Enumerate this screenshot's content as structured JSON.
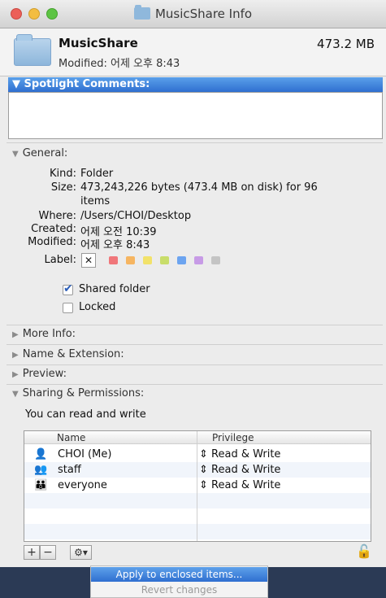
{
  "window": {
    "title": "MusicShare Info"
  },
  "header": {
    "name": "MusicShare",
    "modified": "Modified: 어제 오후 8:43",
    "size": "473.2 MB"
  },
  "spotlight": {
    "title": "Spotlight Comments:"
  },
  "general": {
    "title": "General:",
    "kind_key": "Kind:",
    "kind": "Folder",
    "size_key": "Size:",
    "size_line1": "473,243,226 bytes (473.4 MB on disk) for 96",
    "size_line2": "items",
    "where_key": "Where:",
    "where": "/Users/CHOI/Desktop",
    "created_key": "Created:",
    "created": "어제 오전 10:39",
    "modified_key": "Modified:",
    "modified": "어제 오후 8:43",
    "label_key": "Label:",
    "label_none": "✕",
    "label_colors": [
      "#f0767a",
      "#f6b561",
      "#f2e26a",
      "#c8dd6a",
      "#6ca4f0",
      "#c79be6",
      "#c4c4c4"
    ],
    "shared_folder": "Shared folder",
    "locked": "Locked"
  },
  "sections": {
    "more_info": "More Info:",
    "name_ext": "Name & Extension:",
    "preview": "Preview:",
    "sharing": "Sharing & Permissions:"
  },
  "sharing": {
    "note": "You can read and write",
    "columns": [
      "Name",
      "Privilege"
    ],
    "rows": [
      {
        "icon": "single-user-icon",
        "name": "CHOI (Me)",
        "privilege": "Read & Write"
      },
      {
        "icon": "group-icon",
        "name": "staff",
        "privilege": "Read & Write"
      },
      {
        "icon": "everyone-icon",
        "name": "everyone",
        "privilege": "Read & Write"
      }
    ],
    "add": "+",
    "remove": "−",
    "gear": "⚙▾"
  },
  "menu": {
    "apply": "Apply to enclosed items...",
    "revert": "Revert changes"
  }
}
